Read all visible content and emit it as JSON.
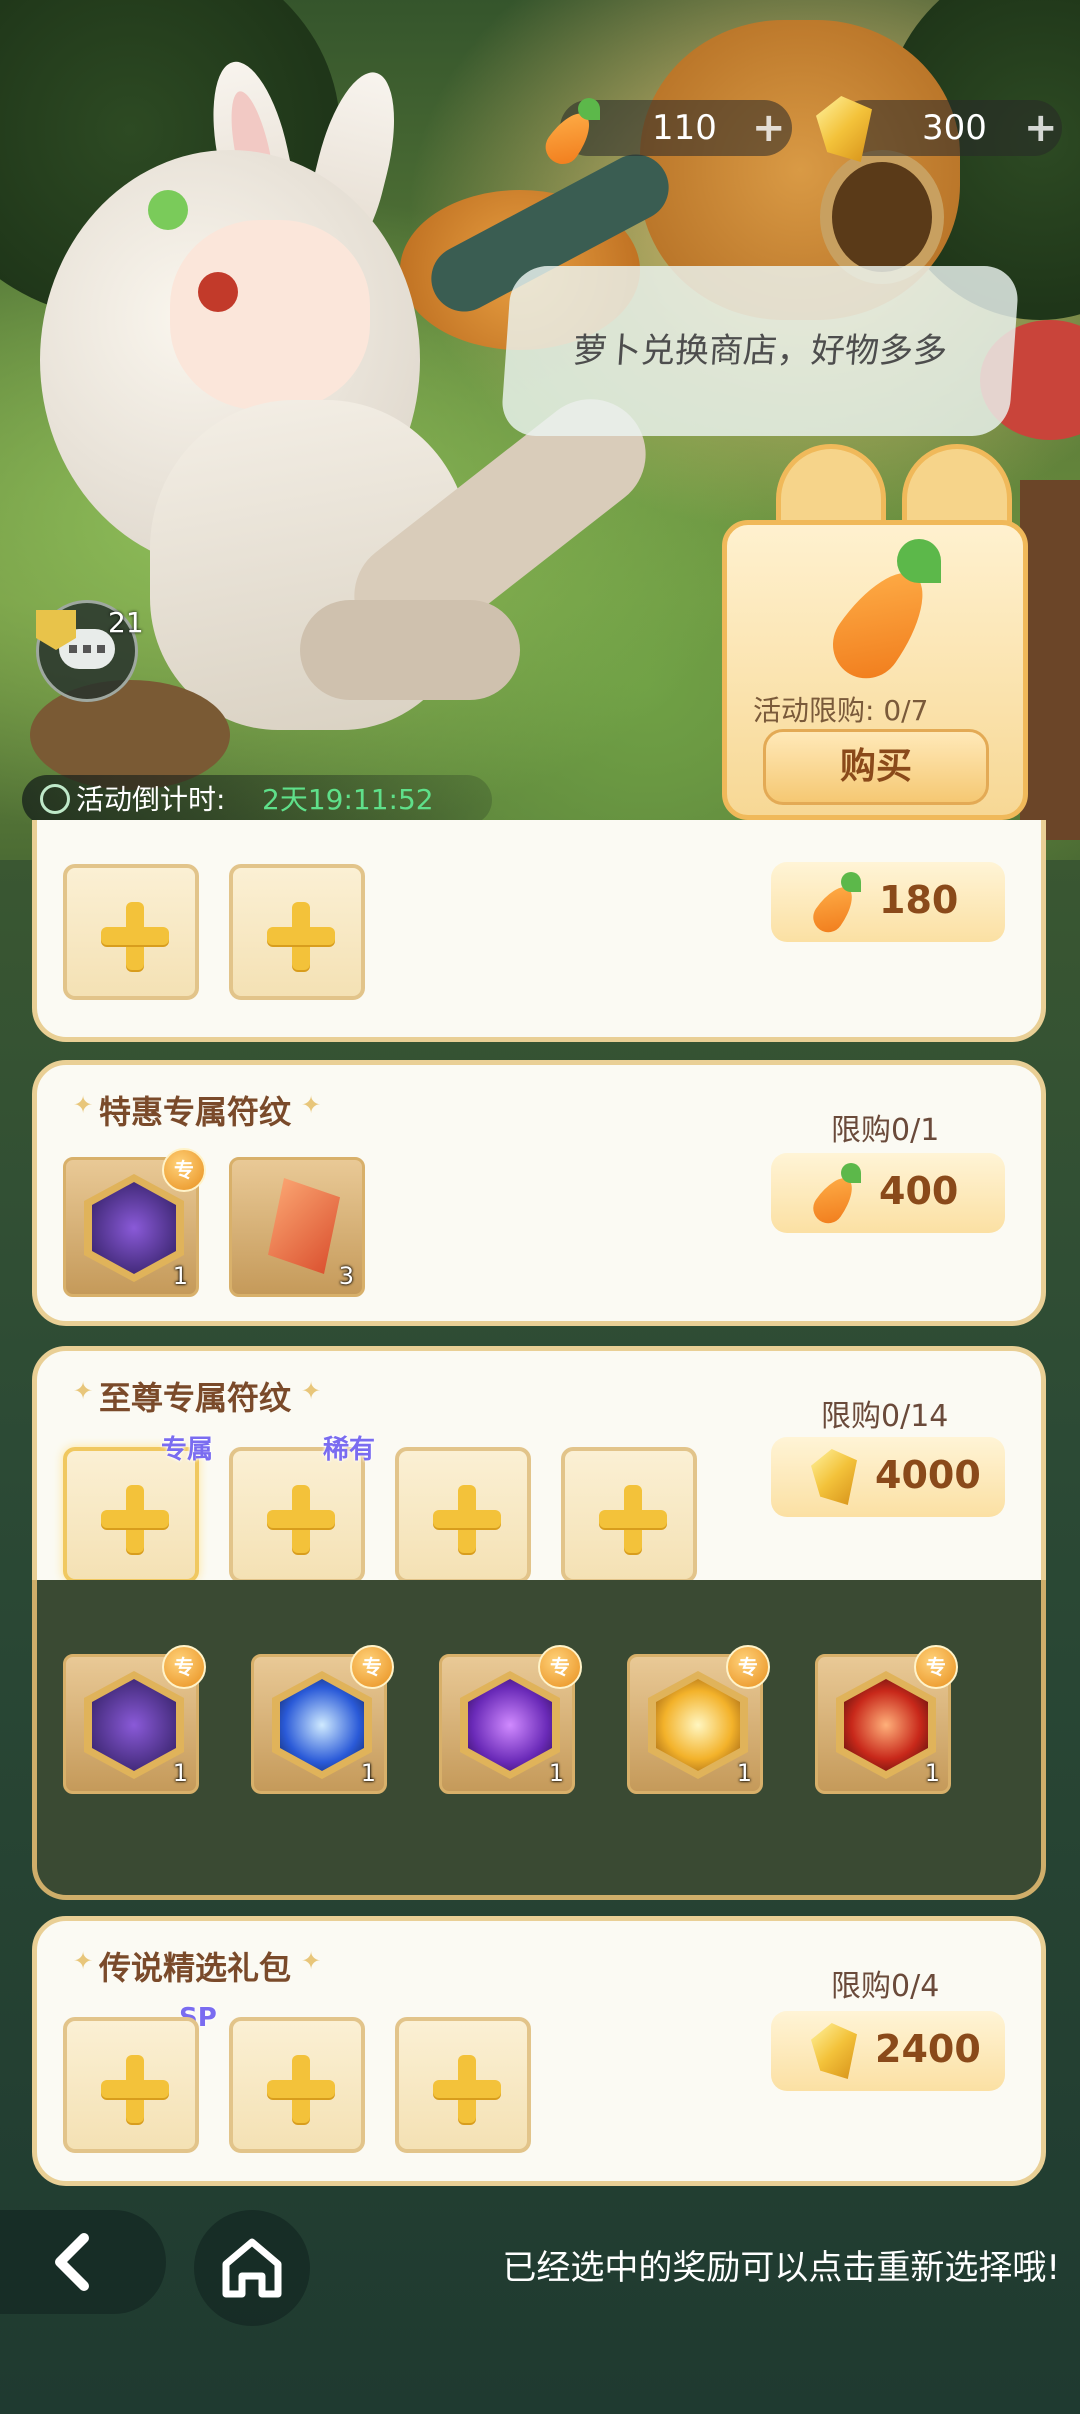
{
  "currency": {
    "carrot_count": "110",
    "crystal_count": "300",
    "add_symbol": "+"
  },
  "npc": {
    "speech": "萝卜兑换商店，好物多多",
    "chat_count": "21"
  },
  "featured": {
    "limit_label": "活动限购: 0/7",
    "buy_label": "购买"
  },
  "countdown": {
    "label": "活动倒计时:",
    "value": "2天19:11:52"
  },
  "packs": [
    {
      "title": "",
      "limit": "",
      "price": "180",
      "currency_icon": "carrot-icon"
    },
    {
      "title": "特惠专属符纹",
      "limit": "限购0/1",
      "price": "400",
      "currency_icon": "carrot-icon",
      "items": [
        {
          "icon": "purple-wing-rune-icon",
          "qty": "1",
          "badge": "专"
        },
        {
          "icon": "orange-crystal-ring-icon",
          "qty": "3"
        }
      ]
    },
    {
      "title": "至尊专属符纹",
      "limit": "限购0/14",
      "price": "4000",
      "currency_icon": "crystal-icon",
      "slot_tags": [
        "专属",
        "稀有"
      ],
      "choices": [
        {
          "icon": "purple-wing-rune-icon",
          "qty": "1",
          "badge": "专"
        },
        {
          "icon": "blue-frost-rune-icon",
          "qty": "1",
          "badge": "专"
        },
        {
          "icon": "violet-heart-rune-icon",
          "qty": "1",
          "badge": "专"
        },
        {
          "icon": "golden-burst-rune-icon",
          "qty": "1",
          "badge": "专"
        },
        {
          "icon": "red-fire-rune-icon",
          "qty": "1",
          "badge": "专"
        }
      ]
    },
    {
      "title": "传说精选礼包",
      "limit": "限购0/4",
      "price": "2400",
      "currency_icon": "crystal-icon",
      "slot_tags": [
        "SP"
      ]
    }
  ],
  "footer": {
    "hint": "已经选中的奖励可以点击重新选择哦!"
  },
  "colors": {
    "accent_gold": "#f3c23a",
    "panel_border": "#e9cf95",
    "title_brown": "#7a4a2a",
    "countdown_green": "#5fe08a"
  }
}
